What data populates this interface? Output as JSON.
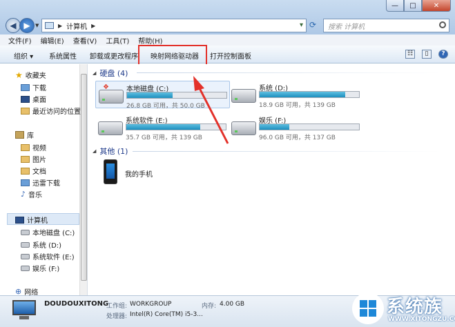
{
  "address": {
    "crumbs": [
      "计算机"
    ],
    "search_placeholder": "搜索 计算机"
  },
  "window": {
    "min": "—",
    "max": "□",
    "close": "✕"
  },
  "menu": [
    "文件(F)",
    "编辑(E)",
    "查看(V)",
    "工具(T)",
    "帮助(H)"
  ],
  "toolbar": [
    "组织 ▾",
    "系统属性",
    "卸载或更改程序",
    "映射网络驱动器",
    "打开控制面板"
  ],
  "nav": {
    "favorites": {
      "label": "收藏夹",
      "items": [
        "下载",
        "桌面",
        "最近访问的位置"
      ]
    },
    "libraries": {
      "label": "库",
      "items": [
        "视频",
        "图片",
        "文档",
        "迅雷下载",
        "音乐"
      ]
    },
    "computer": {
      "label": "计算机",
      "items": [
        "本地磁盘 (C:)",
        "系统 (D:)",
        "系统软件 (E:)",
        "娱乐 (F:)"
      ]
    },
    "network": {
      "label": "网络"
    }
  },
  "groups": {
    "hdd": {
      "label": "硬盘 (4)"
    },
    "other": {
      "label": "其他 (1)"
    }
  },
  "drives": [
    {
      "name": "本地磁盘 (C:)",
      "info": "26.8 GB 可用，共 50.0 GB",
      "used_fraction": 0.46,
      "selected": true
    },
    {
      "name": "系统 (D:)",
      "info": "18.9 GB 可用，共 139 GB",
      "used_fraction": 0.86,
      "selected": false
    },
    {
      "name": "系统软件 (E:)",
      "info": "35.7 GB 可用，共 139 GB",
      "used_fraction": 0.74,
      "selected": false
    },
    {
      "name": "娱乐 (F:)",
      "info": "96.0 GB 可用，共 137 GB",
      "used_fraction": 0.3,
      "selected": false
    }
  ],
  "other_device": {
    "name": "我的手机"
  },
  "details": {
    "computer_name": "DOUDOUXITONG",
    "workgroup_label": "工作组:",
    "workgroup": "WORKGROUP",
    "memory_label": "内存:",
    "memory": "4.00 GB",
    "processor_label": "处理器:",
    "processor": "Intel(R) Core(TM) i5-3..."
  },
  "watermark": {
    "text": "系统族",
    "url": "WWW.XITONGZU.COM"
  }
}
